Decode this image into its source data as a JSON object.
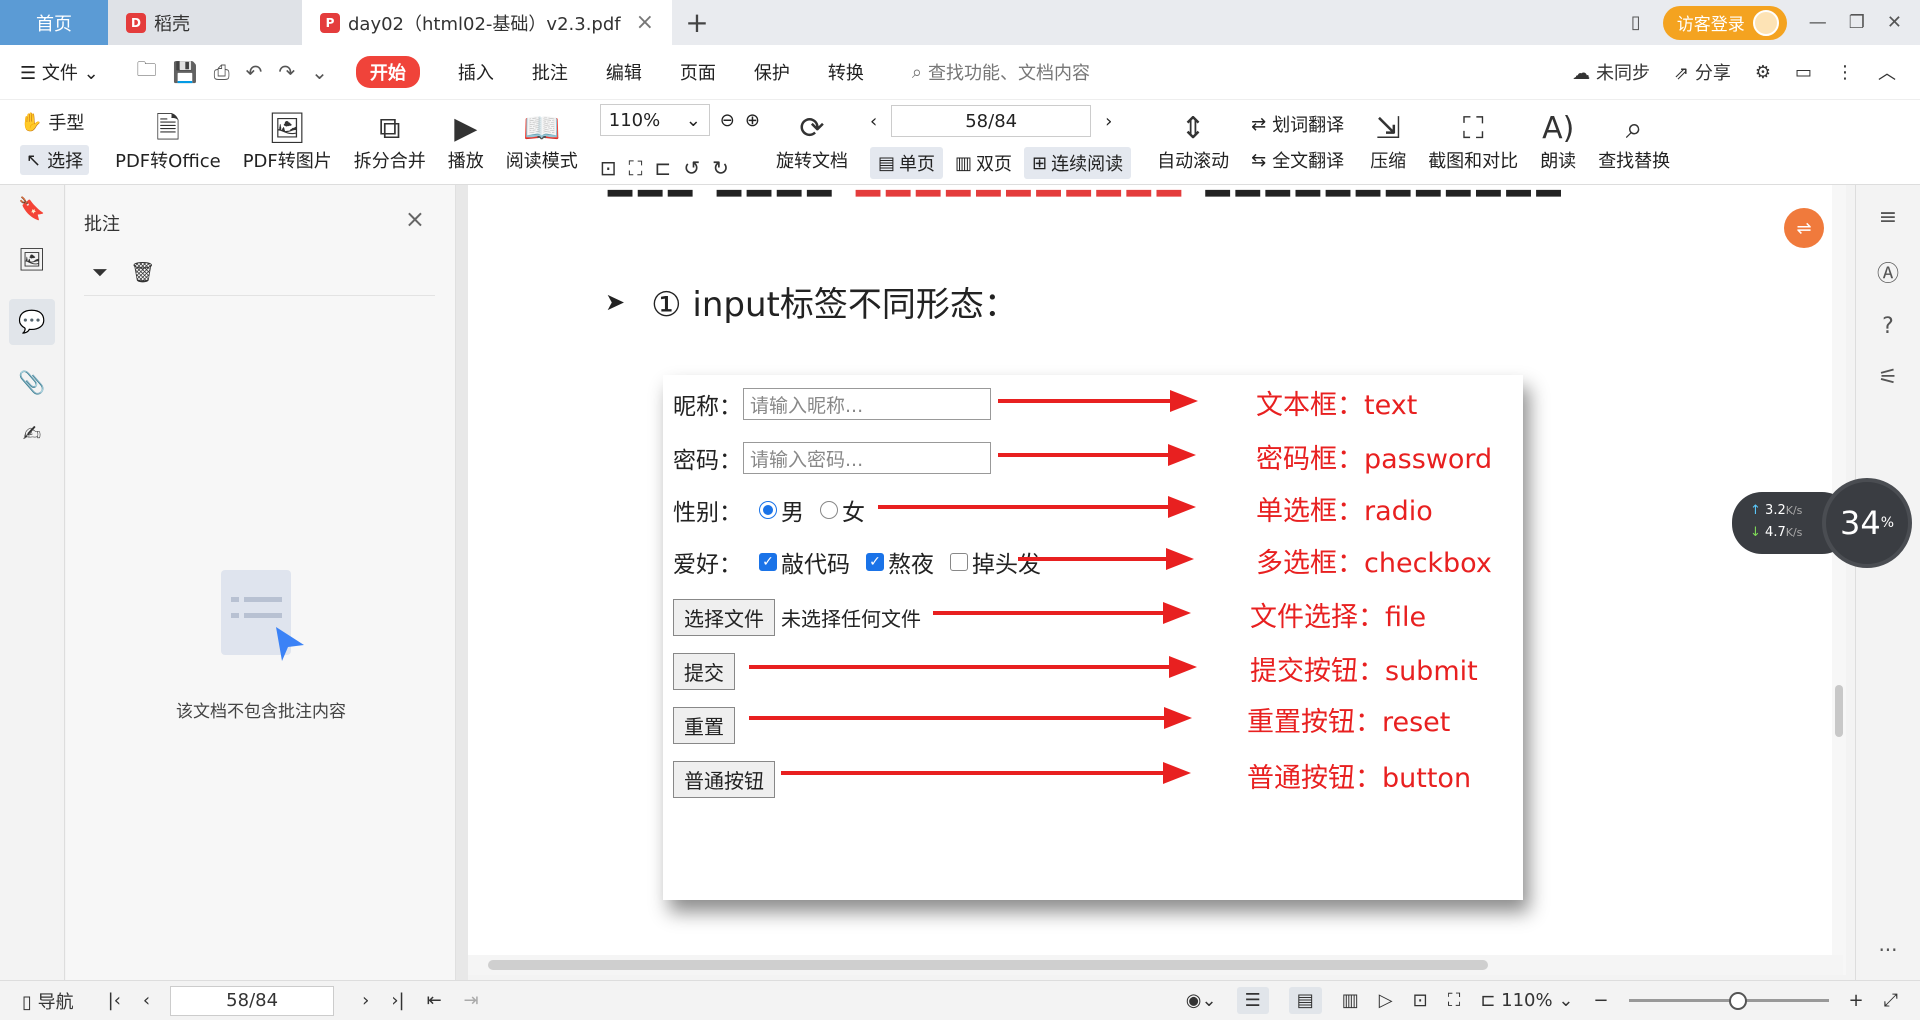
{
  "tabs": [
    {
      "label": "首页"
    },
    {
      "label": "稻壳"
    },
    {
      "label": "day02（html02-基础）v2.3.pdf"
    }
  ],
  "titlebar": {
    "login_label": "访客登录"
  },
  "menubar": {
    "file_label": "文件",
    "items": [
      "开始",
      "插入",
      "批注",
      "编辑",
      "页面",
      "保护",
      "转换"
    ],
    "search_placeholder": "查找功能、文档内容",
    "sync_label": "未同步",
    "share_label": "分享"
  },
  "ribbon": {
    "hand_label": "手型",
    "select_label": "选择",
    "pdf_to_office": "PDF转Office",
    "pdf_to_image": "PDF转图片",
    "split_merge": "拆分合并",
    "play": "播放",
    "read_mode": "阅读模式",
    "zoom": "110%",
    "rotate_doc": "旋转文档",
    "page_indicator": "58/84",
    "single_page": "单页",
    "double_page": "双页",
    "continuous_read": "连续阅读",
    "auto_scroll": "自动滚动",
    "word_translate": "划词翻译",
    "full_translate": "全文翻译",
    "compress": "压缩",
    "screenshot_compare": "截图和对比",
    "read_aloud": "朗读",
    "find_replace": "查找替换"
  },
  "annot_panel": {
    "title": "批注",
    "empty_text": "该文档不包含批注内容"
  },
  "document": {
    "heading": "① input标签不同形态：",
    "figure": {
      "nickname_label": "昵称：",
      "nickname_placeholder": "请输入昵称...",
      "password_label": "密码：",
      "password_placeholder": "请输入密码...",
      "gender_label": "性别：",
      "gender_male": "男",
      "gender_female": "女",
      "hobby_label": "爱好：",
      "hobby_1": "敲代码",
      "hobby_2": "熬夜",
      "hobby_3": "掉头发",
      "file_button": "选择文件",
      "file_status": "未选择任何文件",
      "submit_button": "提交",
      "reset_button": "重置",
      "normal_button": "普通按钮",
      "annotations": [
        "文本框：text",
        "密码框：password",
        "单选框：radio",
        "多选框：checkbox",
        "文件选择：file",
        "提交按钮：submit",
        "重置按钮：reset",
        "普通按钮：button"
      ]
    }
  },
  "netspeed": {
    "up": "3.2",
    "down": "4.7",
    "unit": "K/s",
    "percent": "34",
    "percent_unit": "%"
  },
  "statusbar": {
    "nav_label": "导航",
    "page": "58/84",
    "zoom": "110%"
  },
  "colors": {
    "accent_red": "#e82020",
    "home_tab": "#5b9bd5",
    "login_orange": "#f4a320"
  }
}
